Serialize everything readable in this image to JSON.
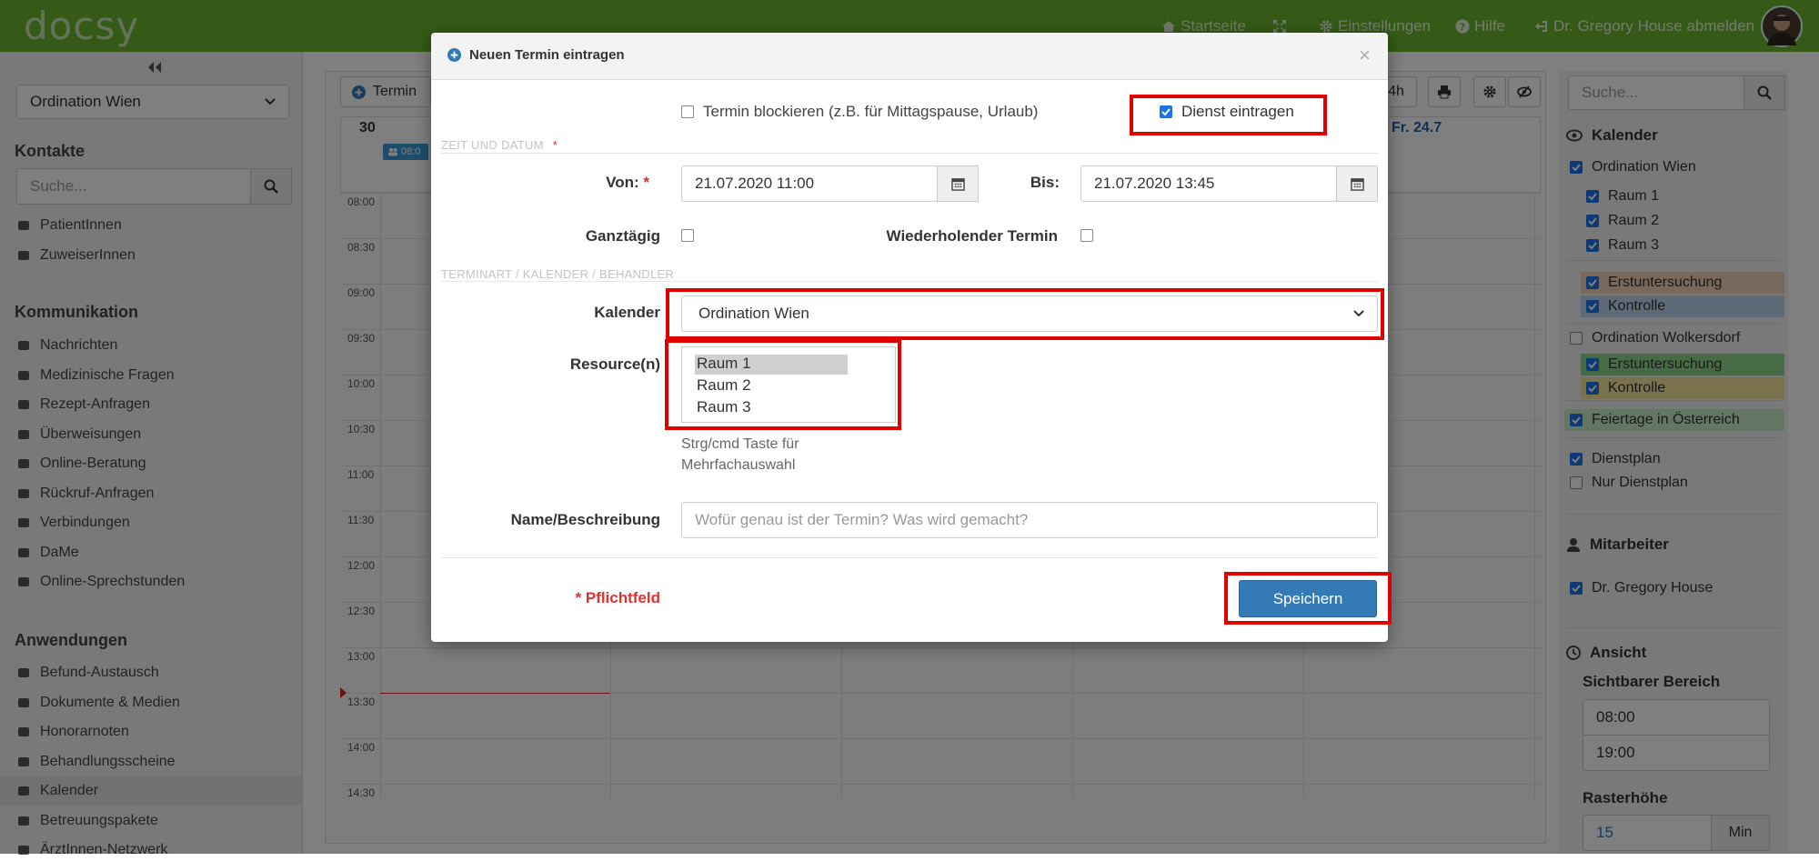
{
  "topbar": {
    "logo": "docsy",
    "nav": [
      {
        "label": "Startseite",
        "icon": "home-icon"
      },
      {
        "label": "",
        "icon": "expand-icon"
      },
      {
        "label": "Einstellungen",
        "icon": "gear-icon"
      },
      {
        "label": "Hilfe",
        "icon": "help-icon"
      },
      {
        "label": "Dr. Gregory House abmelden",
        "icon": "logout-icon"
      }
    ]
  },
  "left": {
    "location": "Ordination Wien",
    "kontakte": {
      "title": "Kontakte",
      "search_placeholder": "Suche...",
      "items": [
        "PatientInnen",
        "ZuweiserInnen"
      ]
    },
    "kommunikation": {
      "title": "Kommunikation",
      "items": [
        "Nachrichten",
        "Medizinische Fragen",
        "Rezept-Anfragen",
        "Überweisungen",
        "Online-Beratung",
        "Rückruf-Anfragen",
        "Verbindungen",
        "DaMe",
        "Online-Sprechstunden"
      ]
    },
    "anwendungen": {
      "title": "Anwendungen",
      "items": [
        "Befund-Austausch",
        "Dokumente & Medien",
        "Honorarnoten",
        "Behandlungsscheine",
        "Kalender",
        "Betreuungspakete",
        "ÄrztInnen-Netzwerk"
      ]
    }
  },
  "calendar": {
    "new_button": "Termin",
    "view_button": "4h",
    "day_first": "30",
    "day_last": "Fr. 24.7",
    "event_label": "08:0",
    "times": [
      "08:00",
      "08:30",
      "09:00",
      "09:30",
      "10:00",
      "10:30",
      "11:00",
      "11:30",
      "12:00",
      "12:30",
      "13:00",
      "13:30",
      "14:00",
      "14:30"
    ]
  },
  "right": {
    "search_placeholder": "Suche...",
    "kalender_title": "Kalender",
    "wien": "Ordination Wien",
    "wien_rooms": [
      "Raum 1",
      "Raum 2",
      "Raum 3"
    ],
    "wien_types": [
      {
        "label": "Erstuntersuchung",
        "color": "#f2d3b9"
      },
      {
        "label": "Kontrolle",
        "color": "#bdd5ef"
      }
    ],
    "wolkersdorf": "Ordination Wolkersdorf",
    "wolk_types": [
      {
        "label": "Erstuntersuchung",
        "color": "#8fd98a"
      },
      {
        "label": "Kontrolle",
        "color": "#f5e39a"
      }
    ],
    "feiertage": {
      "label": "Feiertage in Österreich",
      "color": "#c8ecc8"
    },
    "dienstplan": "Dienstplan",
    "nur_dienstplan": "Nur Dienstplan",
    "mitarbeiter_title": "Mitarbeiter",
    "mitarbeiter": "Dr. Gregory House",
    "ansicht_title": "Ansicht",
    "sichtbar_label": "Sichtbarer Bereich",
    "from_time": "08:00",
    "to_time": "19:00",
    "raster_label": "Rasterhöhe",
    "raster_value": "15",
    "raster_unit": "Min"
  },
  "modal": {
    "title": "Neuen Termin eintragen",
    "block_label": "Termin blockieren (z.B. für Mittagspause, Urlaub)",
    "block_checked": false,
    "dienst_label": "Dienst eintragen",
    "dienst_checked": true,
    "section_time": "ZEIT UND DATUM",
    "required_mark": "*",
    "von_label": "Von:",
    "von_value": "21.07.2020 11:00",
    "bis_label": "Bis:",
    "bis_value": "21.07.2020 13:45",
    "ganztaegig_label": "Ganztägig",
    "wiederholend_label": "Wiederholender Termin",
    "section_type": "TERMINART / KALENDER / BEHANDLER",
    "kalender_label": "Kalender",
    "kalender_value": "Ordination Wien",
    "resource_label": "Resource(n)",
    "resources": [
      "Raum 1",
      "Raum 2",
      "Raum 3"
    ],
    "resource_selected": "Raum 1",
    "hint": "Strg/cmd Taste für Mehrfachauswahl",
    "name_label": "Name/Beschreibung",
    "name_placeholder": "Wofür genau ist der Termin? Was wird gemacht?",
    "pflicht": "* Pflichtfeld",
    "save": "Speichern",
    "close": "×"
  }
}
